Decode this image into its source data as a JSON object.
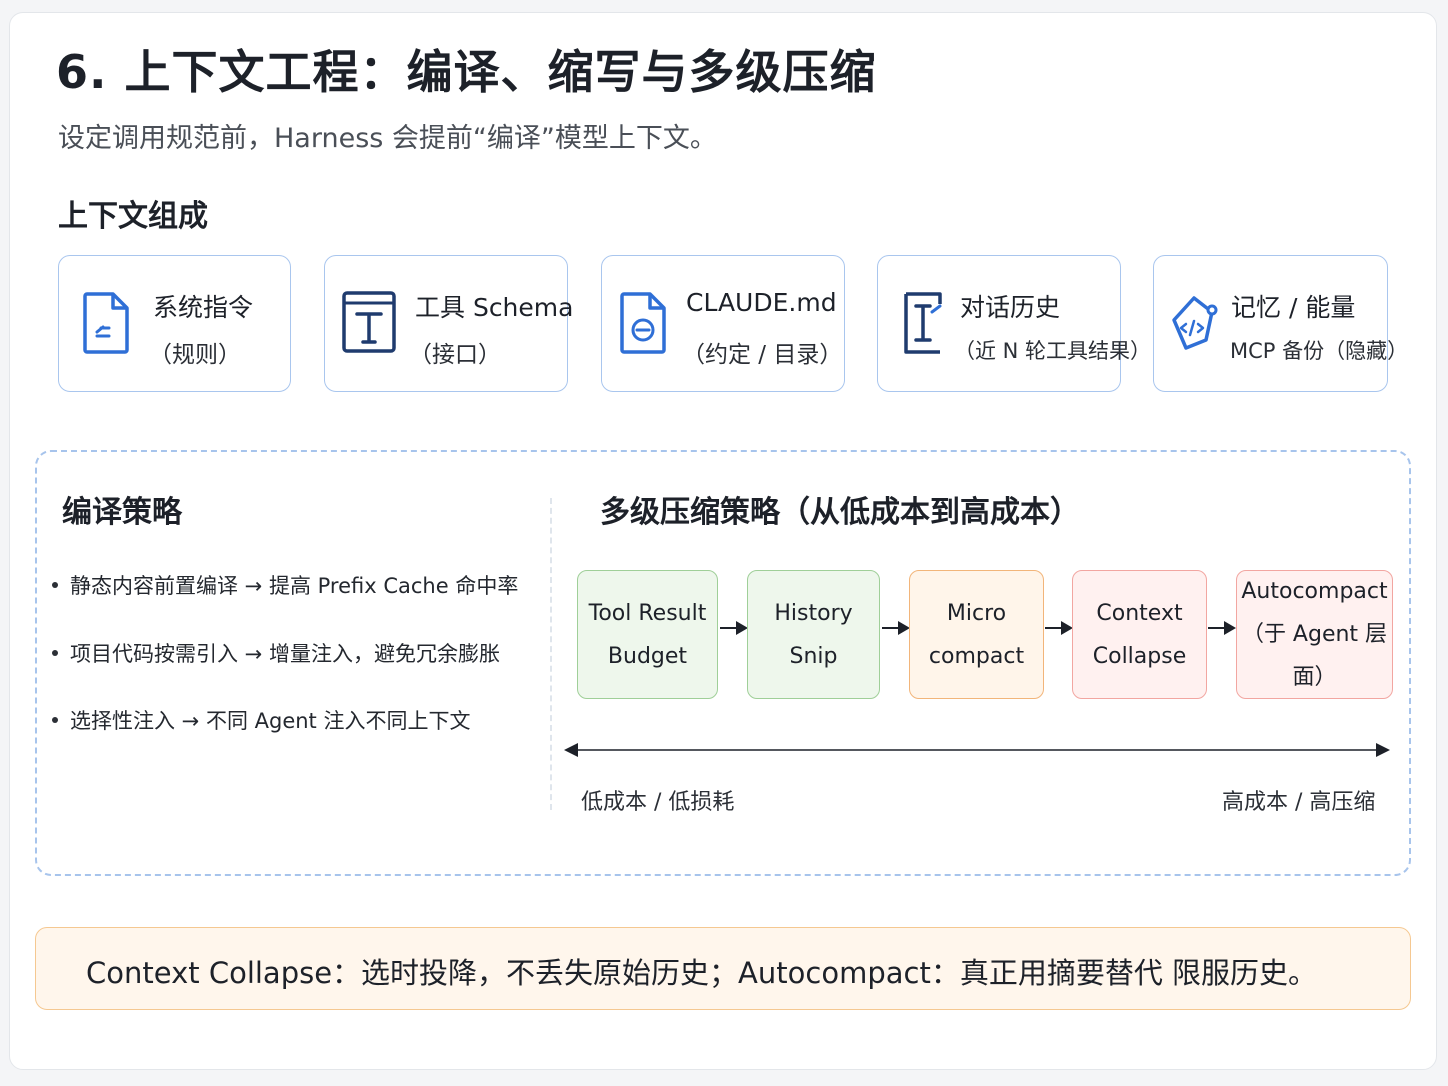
{
  "title": "6. 上下文工程：编译、缩写与多级压缩",
  "subtitle": "设定调用规范前，Harness 会提前“编译”模型上下文。",
  "composition": {
    "title": "上下文组成",
    "cards": [
      {
        "icon": "document-icon",
        "label": "系统指令",
        "sub": "（规则）"
      },
      {
        "icon": "text-icon",
        "label": "工具 Schema",
        "sub": "（接口）"
      },
      {
        "icon": "file-icon",
        "label": "CLAUDE.md",
        "sub": "（约定 / 目录）"
      },
      {
        "icon": "cursor-icon",
        "label": "对话历史",
        "sub": "（近 N 轮工具结果）"
      },
      {
        "icon": "code-icon",
        "label": "记忆 / 能量",
        "sub": "MCP 备份（隐藏）"
      }
    ]
  },
  "compile": {
    "title": "编译策略",
    "bullets": [
      "静态内容前置编译 → 提高 Prefix Cache 命中率",
      "项目代码按需引入 → 增量注入，避免冗余膨胀",
      "选择性注入 → 不同 Agent 注入不同上下文"
    ]
  },
  "compress": {
    "title": "多级压缩策略（从低成本到高成本）",
    "stages": [
      {
        "line1": "Tool Result",
        "line2": "Budget",
        "color": "#9fcf98"
      },
      {
        "line1": "History",
        "line2": "Snip",
        "color": "#9fcf98"
      },
      {
        "line1": "Micro",
        "line2": "compact",
        "color": "#f2b57a"
      },
      {
        "line1": "Context",
        "line2": "Collapse",
        "color": "#f2a6a1"
      },
      {
        "line1": "Autocompact",
        "line2": "（于 Agent 层面）",
        "color": "#f2a6a1"
      }
    ],
    "scale_left": "低成本  /  低损耗",
    "scale_right": "高成本  /  高压缩"
  },
  "note": "Context Collapse：选时投降，不丢失原始历史；Autocompact：真正用摘要替代 限服历史。",
  "colors": {
    "accent": "#2f6fd6",
    "card_border": "#a9c6ee"
  }
}
